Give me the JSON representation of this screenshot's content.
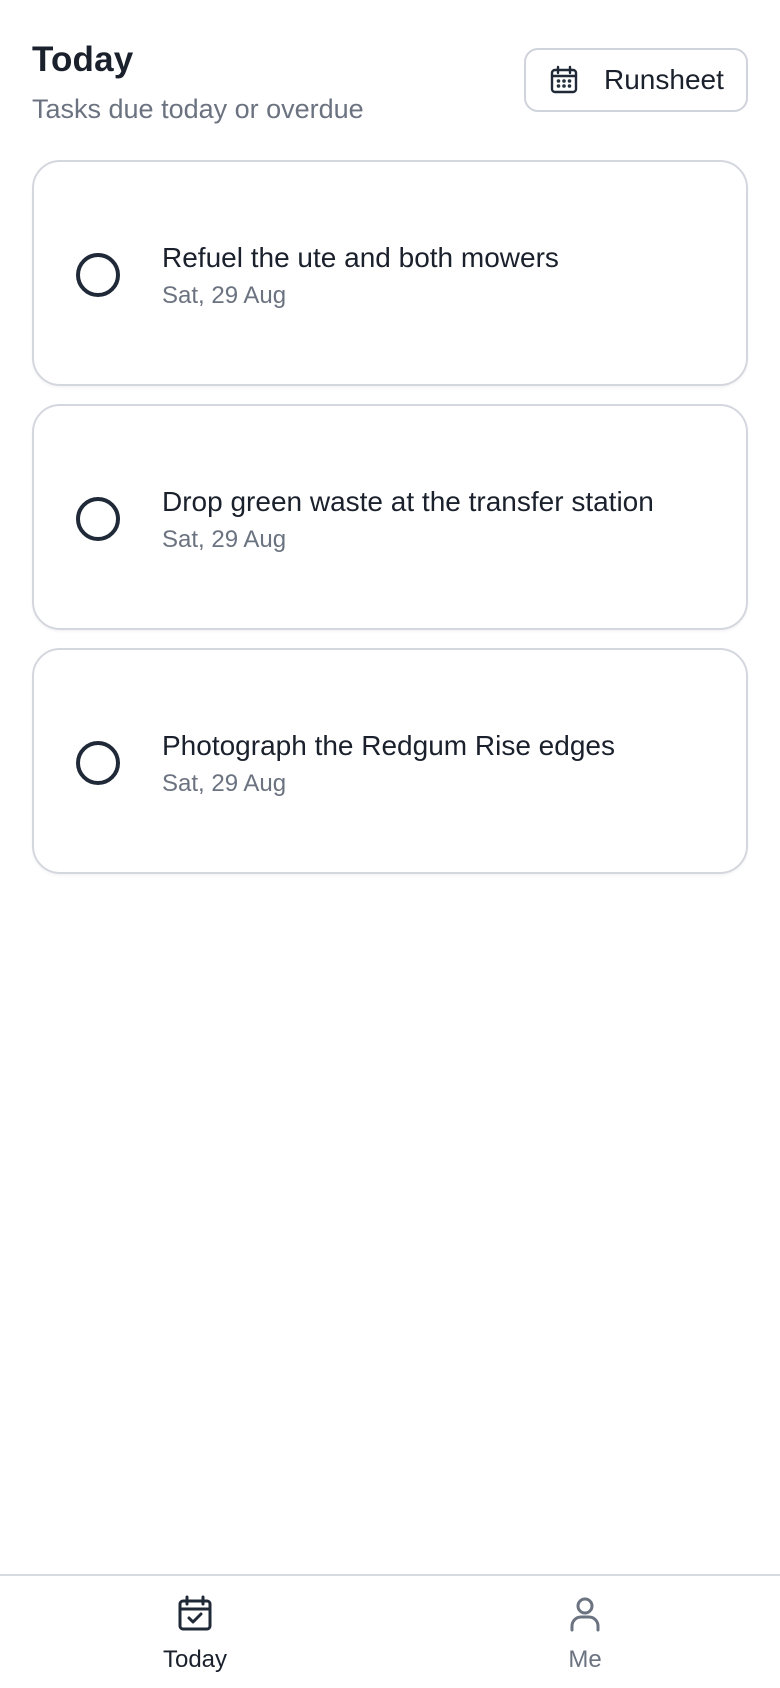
{
  "header": {
    "title": "Today",
    "subtitle": "Tasks due today or overdue",
    "runsheet_button": {
      "label": "Runsheet",
      "icon": "calendar-icon"
    }
  },
  "tasks": [
    {
      "title": "Refuel the ute and both mowers",
      "date": "Sat, 29 Aug",
      "completed": false
    },
    {
      "title": "Drop green waste at the transfer station",
      "date": "Sat, 29 Aug",
      "completed": false
    },
    {
      "title": "Photograph the Redgum Rise edges",
      "date": "Sat, 29 Aug",
      "completed": false
    }
  ],
  "bottom_nav": {
    "items": [
      {
        "label": "Today",
        "icon": "calendar-check-icon",
        "active": true
      },
      {
        "label": "Me",
        "icon": "user-icon",
        "active": false
      }
    ]
  },
  "colors": {
    "text_primary": "#1a202c",
    "text_secondary": "#6b7280",
    "border": "#d4d7de",
    "background": "#ffffff"
  }
}
